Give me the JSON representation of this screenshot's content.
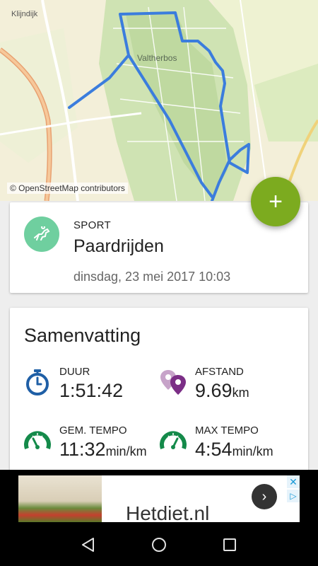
{
  "map": {
    "town_label": "Klijndijk",
    "forest_label": "Valtherbos",
    "attribution": "© OpenStreetMap contributors",
    "route_color": "#3b7ddd",
    "forest_color": "#cfe3b3"
  },
  "fab": {
    "label": "+",
    "color": "#7cab1f"
  },
  "sport_card": {
    "kicker": "SPORT",
    "name": "Paardrijden",
    "date": "dinsdag, 23 mei 2017 10:03",
    "icon": "horse-riding-icon",
    "avatar_color": "#6fcf9f"
  },
  "summary": {
    "title": "Samenvatting",
    "stats": [
      {
        "label": "DUUR",
        "value": "1:51:42",
        "unit": "",
        "icon": "stopwatch-icon"
      },
      {
        "label": "AFSTAND",
        "value": "9.69",
        "unit": "km",
        "icon": "map-pin-icon"
      },
      {
        "label": "GEM. TEMPO",
        "value": "11:32",
        "unit": "min/km",
        "icon": "speedometer-icon"
      },
      {
        "label": "MAX TEMPO",
        "value": "4:54",
        "unit": "min/km",
        "icon": "speedometer-icon"
      }
    ]
  },
  "ad": {
    "text": "Hetdiet.nl",
    "close": "✕",
    "choices": "▷",
    "next": "›"
  },
  "navbar": {
    "back": "back-icon",
    "home": "home-icon",
    "recent": "recent-apps-icon"
  }
}
